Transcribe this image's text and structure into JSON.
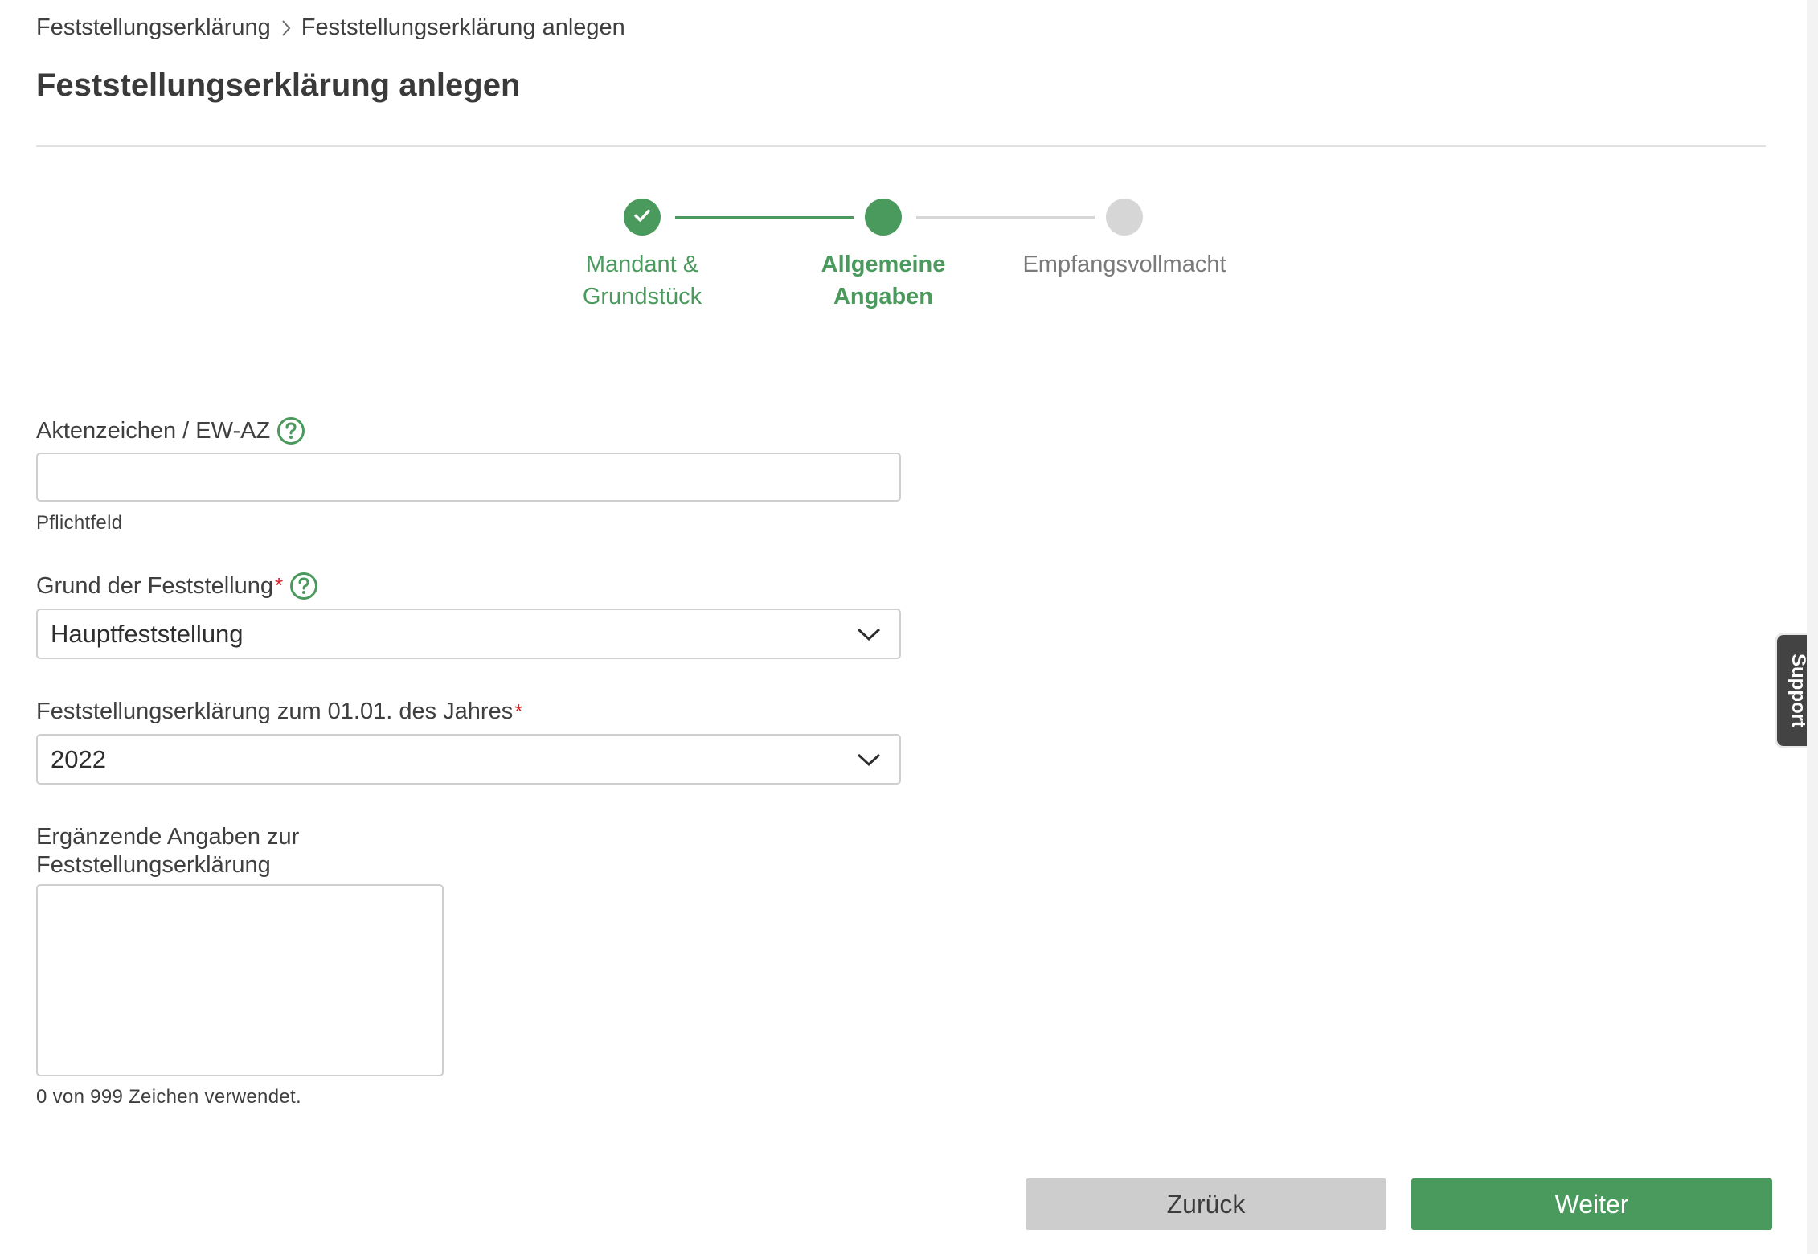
{
  "breadcrumb": {
    "items": [
      "Feststellungserklärung",
      "Feststellungserklärung anlegen"
    ]
  },
  "page_title": "Feststellungserklärung anlegen",
  "stepper": {
    "steps": [
      {
        "line1": "Mandant &",
        "line2": "Grundstück",
        "state": "done"
      },
      {
        "line1": "Allgemeine",
        "line2": "Angaben",
        "state": "active"
      },
      {
        "line1": "Empfangsvollmacht",
        "line2": "",
        "state": "pending"
      }
    ]
  },
  "form": {
    "aktenzeichen": {
      "label": "Aktenzeichen / EW-AZ",
      "value": "",
      "hint": "Pflichtfeld"
    },
    "grund": {
      "label": "Grund der Feststellung",
      "required_mark": "*",
      "value": "Hauptfeststellung"
    },
    "jahr": {
      "label": "Feststellungserklärung zum 01.01. des Jahres",
      "required_mark": "*",
      "value": "2022"
    },
    "ergaenzend": {
      "label_line1": "Ergänzende Angaben zur",
      "label_line2": "Feststellungserklärung",
      "value": "",
      "counter": "0 von 999 Zeichen verwendet."
    }
  },
  "buttons": {
    "back": "Zurück",
    "next": "Weiter"
  },
  "support_tab": "Support",
  "colors": {
    "accent_green": "#4a9a5e",
    "pending_grey": "#d6d6d6",
    "required_red": "#d6262c"
  }
}
